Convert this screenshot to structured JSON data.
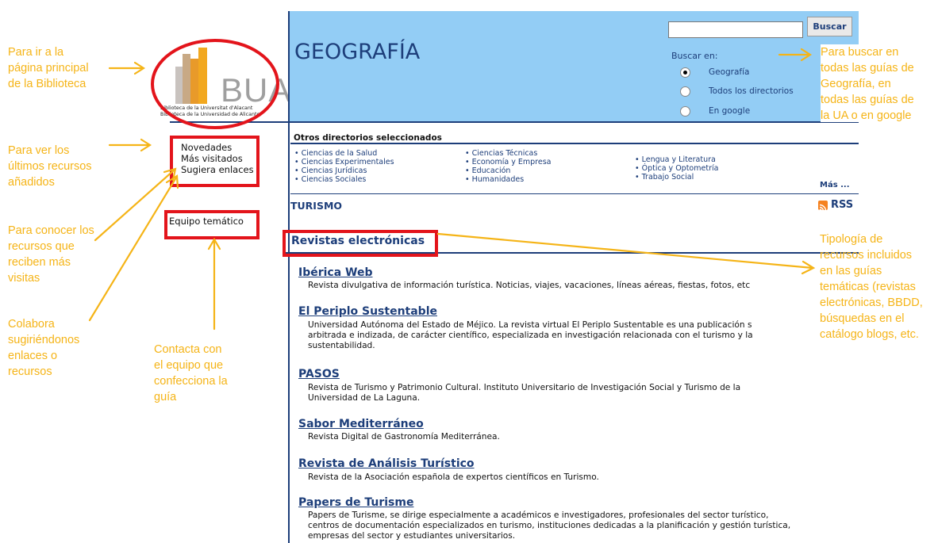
{
  "annotations": {
    "home": "Para ir a la\npágina principal\nde la Biblioteca",
    "novedades": "Para ver los\núltimos  recursos\nañadidos",
    "mas_visitados": "Para conocer los\nrecursos que\nreciben más\nvisitas",
    "sugiera": "Colabora\nsugiriéndonos\nenlaces o\nrecursos",
    "equipo": "Contacta con\nel equipo que\nconfecciona la\nguía",
    "buscar": "Para buscar en\ntodas las guías de\nGeografía, en\ntodas las guías de\nla UA o en google",
    "tipologia": "Tipología de\nrecursos incluidos\nen las guías\ntemáticas (revistas\nelectrónicas, BBDD,\nbúsquedas en el\ncatálogo blogs, etc."
  },
  "logo": {
    "text": "BUA",
    "line1": "Biblioteca de la Universitat d'Alacant",
    "line2": "Biblioteca de la Universidad de Alicante"
  },
  "sidebar": {
    "novedades": "Novedades",
    "mas_visitados": "Más visitados",
    "sugiera": "Sugiera enlaces",
    "equipo": "Equipo temático"
  },
  "header": {
    "title": "GEOGRAFÍA",
    "search_button": "Buscar",
    "search_value": "",
    "buscar_en": "Buscar en:",
    "options": [
      "Geografía",
      "Todos los directorios",
      "En google"
    ],
    "selected": "Geografía"
  },
  "directorios": {
    "title": "Otros directorios seleccionados",
    "col1": [
      "Ciencias de la Salud",
      "Ciencias Experimentales",
      "Ciencias Jurídicas",
      "Ciencias Sociales"
    ],
    "col2": [
      "Ciencias Técnicas",
      "Economía y Empresa",
      "Educación",
      "Humanidades"
    ],
    "col3": [
      "Lengua y Literatura",
      "Óptica y Optometría",
      "Trabajo Social"
    ],
    "mas": "Más ..."
  },
  "turismo": "TURISMO",
  "rss": "RSS",
  "section": "Revistas electrónicas",
  "resources": [
    {
      "title": "Ibérica Web",
      "desc": [
        "Revista divulgativa de información turística. Noticias, viajes, vacaciones, líneas aéreas, fiestas, fotos, etc"
      ]
    },
    {
      "title": "El Periplo Sustentable",
      "desc": [
        "Universidad Autónoma del Estado de Méjico. La revista virtual El Periplo Sustentable es una publicación s",
        "arbitrada e indizada, de carácter científico, especializada en investigación relacionada con el turismo y la",
        "sustentabilidad."
      ]
    },
    {
      "title": "PASOS",
      "desc": [
        "Revista de Turismo y Patrimonio Cultural. Instituto Universitario de Investigación Social y Turismo de la",
        "Universidad de La Laguna."
      ]
    },
    {
      "title": "Sabor Mediterráneo",
      "desc": [
        "Revista Digital de Gastronomía Mediterránea."
      ]
    },
    {
      "title": "Revista de Análisis Turístico",
      "desc": [
        "Revista de la Asociación española de expertos científicos en Turismo."
      ]
    },
    {
      "title": "Papers de Turisme",
      "desc": [
        "Papers de Turisme, se dirige especialmente a académicos e investigadores, profesionales del sector turístico,",
        "centros de documentación especializados en turismo, instituciones dedicadas a la planificación y gestión turística,",
        "empresas del sector y estudiantes universitarios."
      ]
    }
  ],
  "colors": {
    "annotation": "#f5b417",
    "highlight": "#e3141b",
    "header_bg": "#93cdf5",
    "navy": "#1d3e7a"
  }
}
